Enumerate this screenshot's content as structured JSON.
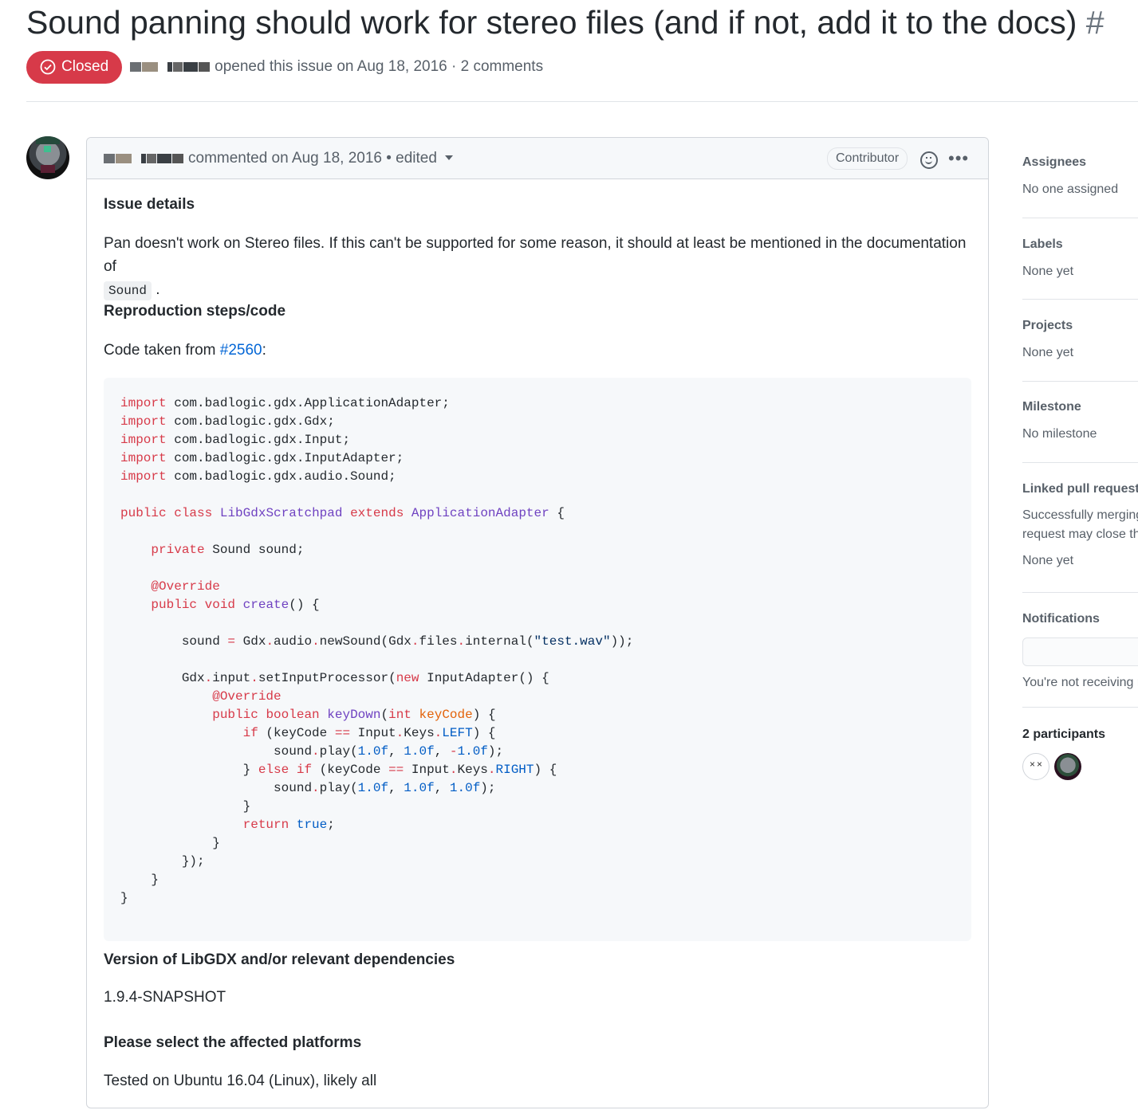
{
  "issue": {
    "title": "Sound panning should work for stereo files (and if not, add it to the docs)",
    "number_prefix": "#",
    "state": "Closed",
    "meta": "opened this issue on Aug 18, 2016 · 2 comments"
  },
  "comment": {
    "header_text": "commented on Aug 18, 2016 • edited",
    "badge": "Contributor",
    "sections": {
      "details_heading": "Issue details",
      "details_text_1": "Pan doesn't work on Stereo files. If this can't be supported for some reason, it should at least be mentioned in the documentation of",
      "details_code": "Sound",
      "details_text_2": ".",
      "repro_heading": "Reproduction steps/code",
      "repro_text": "Code taken from",
      "repro_link": "#2560",
      "repro_colon": ":",
      "version_heading": "Version of LibGDX and/or relevant dependencies",
      "version_text": "1.9.4-SNAPSHOT",
      "platforms_heading": "Please select the affected platforms",
      "platforms_text": "Tested on Ubuntu 16.04 (Linux), likely all"
    },
    "code_lines": [
      [
        [
          "kw",
          "import"
        ],
        [
          "",
          " com.badlogic.gdx.ApplicationAdapter;"
        ]
      ],
      [
        [
          "kw",
          "import"
        ],
        [
          "",
          " com.badlogic.gdx.Gdx;"
        ]
      ],
      [
        [
          "kw",
          "import"
        ],
        [
          "",
          " com.badlogic.gdx.Input;"
        ]
      ],
      [
        [
          "kw",
          "import"
        ],
        [
          "",
          " com.badlogic.gdx.InputAdapter;"
        ]
      ],
      [
        [
          "kw",
          "import"
        ],
        [
          "",
          " com.badlogic.gdx.audio.Sound;"
        ]
      ],
      [],
      [
        [
          "kw",
          "public"
        ],
        [
          "",
          " "
        ],
        [
          "kw",
          "class"
        ],
        [
          "",
          " "
        ],
        [
          "ty",
          "LibGdxScratchpad"
        ],
        [
          "",
          " "
        ],
        [
          "kw",
          "extends"
        ],
        [
          "",
          " "
        ],
        [
          "ty",
          "ApplicationAdapter"
        ],
        [
          "",
          " {"
        ]
      ],
      [],
      [
        [
          "",
          "    "
        ],
        [
          "kw",
          "private"
        ],
        [
          "",
          " Sound sound;"
        ]
      ],
      [],
      [
        [
          "",
          "    "
        ],
        [
          "kw",
          "@Override"
        ]
      ],
      [
        [
          "",
          "    "
        ],
        [
          "kw",
          "public"
        ],
        [
          "",
          " "
        ],
        [
          "kw",
          "void"
        ],
        [
          "",
          " "
        ],
        [
          "ty",
          "create"
        ],
        [
          "",
          "() {"
        ]
      ],
      [],
      [
        [
          "",
          "        sound "
        ],
        [
          "kw",
          "="
        ],
        [
          "",
          " Gdx"
        ],
        [
          "kw",
          "."
        ],
        [
          "",
          "audio"
        ],
        [
          "kw",
          "."
        ],
        [
          "",
          "newSound(Gdx"
        ],
        [
          "kw",
          "."
        ],
        [
          "",
          "files"
        ],
        [
          "kw",
          "."
        ],
        [
          "",
          "internal("
        ],
        [
          "st",
          "\"test.wav\""
        ],
        [
          "",
          "));"
        ]
      ],
      [],
      [
        [
          "",
          "        Gdx"
        ],
        [
          "kw",
          "."
        ],
        [
          "",
          "input"
        ],
        [
          "kw",
          "."
        ],
        [
          "",
          "setInputProcessor("
        ],
        [
          "kw",
          "new"
        ],
        [
          "",
          " InputAdapter() {"
        ]
      ],
      [
        [
          "",
          "            "
        ],
        [
          "kw",
          "@Override"
        ]
      ],
      [
        [
          "",
          "            "
        ],
        [
          "kw",
          "public"
        ],
        [
          "",
          " "
        ],
        [
          "kw",
          "boolean"
        ],
        [
          "",
          " "
        ],
        [
          "ty",
          "keyDown"
        ],
        [
          "",
          "("
        ],
        [
          "kw",
          "int"
        ],
        [
          "",
          " "
        ],
        [
          "pa",
          "keyCode"
        ],
        [
          "",
          ") {"
        ]
      ],
      [
        [
          "",
          "                "
        ],
        [
          "kw",
          "if"
        ],
        [
          "",
          " (keyCode "
        ],
        [
          "kw",
          "=="
        ],
        [
          "",
          " Input"
        ],
        [
          "kw",
          "."
        ],
        [
          "",
          "Keys"
        ],
        [
          "kw",
          "."
        ],
        [
          "nu",
          "LEFT"
        ],
        [
          "",
          ") {"
        ]
      ],
      [
        [
          "",
          "                    sound"
        ],
        [
          "kw",
          "."
        ],
        [
          "",
          "play("
        ],
        [
          "nu",
          "1.0f"
        ],
        [
          "",
          ", "
        ],
        [
          "nu",
          "1.0f"
        ],
        [
          "",
          ", "
        ],
        [
          "kw",
          "-"
        ],
        [
          "nu",
          "1.0f"
        ],
        [
          "",
          ");"
        ]
      ],
      [
        [
          "",
          "                } "
        ],
        [
          "kw",
          "else"
        ],
        [
          "",
          " "
        ],
        [
          "kw",
          "if"
        ],
        [
          "",
          " (keyCode "
        ],
        [
          "kw",
          "=="
        ],
        [
          "",
          " Input"
        ],
        [
          "kw",
          "."
        ],
        [
          "",
          "Keys"
        ],
        [
          "kw",
          "."
        ],
        [
          "nu",
          "RIGHT"
        ],
        [
          "",
          ") {"
        ]
      ],
      [
        [
          "",
          "                    sound"
        ],
        [
          "kw",
          "."
        ],
        [
          "",
          "play("
        ],
        [
          "nu",
          "1.0f"
        ],
        [
          "",
          ", "
        ],
        [
          "nu",
          "1.0f"
        ],
        [
          "",
          ", "
        ],
        [
          "nu",
          "1.0f"
        ],
        [
          "",
          ");"
        ]
      ],
      [
        [
          "",
          "                }"
        ]
      ],
      [
        [
          "",
          "                "
        ],
        [
          "kw",
          "return"
        ],
        [
          "",
          " "
        ],
        [
          "nu",
          "true"
        ],
        [
          "",
          ";"
        ]
      ],
      [
        [
          "",
          "            }"
        ]
      ],
      [
        [
          "",
          "        });"
        ]
      ],
      [
        [
          "",
          "    }"
        ]
      ],
      [
        [
          "",
          "}"
        ]
      ]
    ]
  },
  "sidebar": {
    "assignees_title": "Assignees",
    "assignees_value": "No one assigned",
    "labels_title": "Labels",
    "labels_value": "None yet",
    "projects_title": "Projects",
    "projects_value": "None yet",
    "milestone_title": "Milestone",
    "milestone_value": "No milestone",
    "linked_title": "Linked pull requests",
    "linked_desc": "Successfully merging a pull request may close this issue.",
    "linked_value": "None yet",
    "notifications_title": "Notifications",
    "notifications_desc": "You're not receiving notifications from this thread.",
    "participants_title": "2 participants"
  },
  "colors": {
    "closed": "#d73a49",
    "link": "#0366d6",
    "keyword": "#d73a49",
    "type": "#6f42c1",
    "number": "#005cc5"
  }
}
